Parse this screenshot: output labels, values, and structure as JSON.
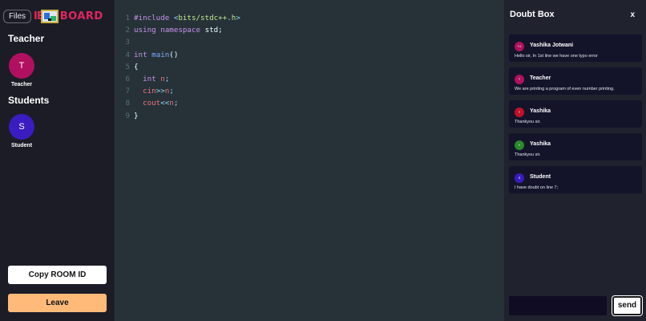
{
  "sidebar": {
    "files_label": "Files",
    "logo_prefix": "IE",
    "logo_text": "BOARD",
    "teacher_heading": "Teacher",
    "students_heading": "Students",
    "teacher": {
      "initial": "T",
      "name": "Teacher",
      "color": "#b0105f"
    },
    "student": {
      "initial": "S",
      "name": "Student",
      "color": "#3a1cc0"
    },
    "copy_room_label": "Copy ROOM ID",
    "leave_label": "Leave",
    "leave_color": "#ffba7a"
  },
  "editor": {
    "lines": [
      {
        "num": "1"
      },
      {
        "num": "2"
      },
      {
        "num": "3"
      },
      {
        "num": "4"
      },
      {
        "num": "5"
      },
      {
        "num": "6"
      },
      {
        "num": "7"
      },
      {
        "num": "8"
      },
      {
        "num": "9"
      }
    ],
    "tokens": {
      "include": "#include",
      "lt": "<",
      "header_name": "bits/stdc++",
      "dot": ".",
      "header_ext": "h",
      "gt": ">",
      "using": "using",
      "namespace": "namespace",
      "std": "std;",
      "int": "int",
      "main": "main",
      "parens": "()",
      "open_brace": "{",
      "int2": "int",
      "n_decl": "n",
      "semi": ";",
      "cin": "cin",
      "shr": ">>",
      "n_cin": "n",
      "cout": "cout",
      "shl": "<<",
      "n_cout": "n",
      "close_brace": "}"
    }
  },
  "doubt_box": {
    "title": "Doubt Box",
    "close_label": "x",
    "messages": [
      {
        "initials": "YJ",
        "name": "Yashika Jotwani",
        "text": "Hello sir, In 1st line we have one typo error",
        "color": "#b0105f"
      },
      {
        "initials": "T",
        "name": "Teacher",
        "text": "We are printing a program of even number printing.",
        "color": "#b0105f"
      },
      {
        "initials": "Y",
        "name": "Yashika",
        "text": "Thankyou sir.",
        "color": "#c0102a"
      },
      {
        "initials": "Y",
        "name": "Yashika",
        "text": "Thankyou sir.",
        "color": "#2a8a2a"
      },
      {
        "initials": "S",
        "name": "Student",
        "text": "I have doubt on line 7;",
        "color": "#3a1cc0"
      }
    ],
    "input_value": "",
    "send_label": "send"
  }
}
